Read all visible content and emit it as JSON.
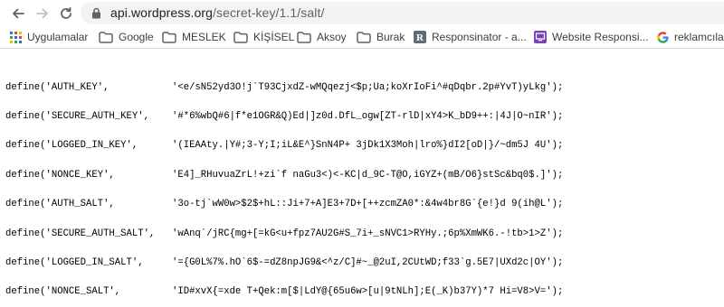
{
  "browser": {
    "url_host": "api.wordpress.org",
    "url_path": "/secret-key/1.1/salt/"
  },
  "bookmarks": [
    {
      "label": "Uygulamalar",
      "icon": "apps-grid-icon"
    },
    {
      "label": "Google",
      "icon": "folder-icon"
    },
    {
      "label": "MESLEK",
      "icon": "folder-icon"
    },
    {
      "label": "KİŞİSEL",
      "icon": "folder-icon"
    },
    {
      "label": "Aksoy",
      "icon": "folder-icon"
    },
    {
      "label": "Burak",
      "icon": "folder-icon"
    },
    {
      "label": "Responsinator - a...",
      "icon": "responsinator-r-icon"
    },
    {
      "label": "Website Responsi...",
      "icon": "website-responsive-icon"
    },
    {
      "label": "reklamcılar",
      "icon": "google-g-icon"
    }
  ],
  "colors": {
    "folder": "#5f6368",
    "omnibox_bg": "#f1f3f4",
    "responsinator": "#5f6b76",
    "website_responsive": "#7b3fb6"
  },
  "page": {
    "lines": [
      {
        "key": "define('AUTH_KEY',",
        "value": "'<e/sN52yd3O!j`T93CjxdZ-wMQqezj<$p;Ua;koXrIoFi^#qDqbr.2p#YvT)yLkg');"
      },
      {
        "key": "define('SECURE_AUTH_KEY',",
        "value": "'#*6%wbQ#6|f*e1OGR&Q)Ed|]z0d.DfL_ogw[ZT-rlD|xY4>K_bD9++:|4J|O~nIR');"
      },
      {
        "key": "define('LOGGED_IN_KEY',",
        "value": "'(IEAAty.|Y#;3-Y;I;iL&E^}SnN4P+ 3jDk1X3Moh|lro%}dI2[oD|}/~dm5J 4U');"
      },
      {
        "key": "define('NONCE_KEY',",
        "value": "'E4]_RHuvuaZrL!+zi`f naGu3<)<-KC|d_9C-T@O,iGYZ+(mB/O6}stSc&bq0$.]');"
      },
      {
        "key": "define('AUTH_SALT',",
        "value": "'3o-tj`wW0w>$2$+hL::Ji+7+A]E3+7D+[++zcmZA0*:&4w4br8G`{e!}d 9(ih@L');"
      },
      {
        "key": "define('SECURE_AUTH_SALT',",
        "value": "'wAnq`/jRC{mg+[=kG<u+fpz7AU2G#S_7i+_sNVC1>RYHy.;6p%XmWK6.-!tb>1>Z');"
      },
      {
        "key": "define('LOGGED_IN_SALT',",
        "value": "'={G0L%7%.hO`6$-=dZ8npJG9&<^z/C]#~_@2uI,2CUtWD;f33`g.5E7|UXd2c|OY');"
      },
      {
        "key": "define('NONCE_SALT',",
        "value": "'ID#xvX{=xde T+Qek:m[$|LdY@{65u6w>[u|9tNLh];E(_K)b37Y)*7 Hi=V8>V=');"
      }
    ]
  }
}
